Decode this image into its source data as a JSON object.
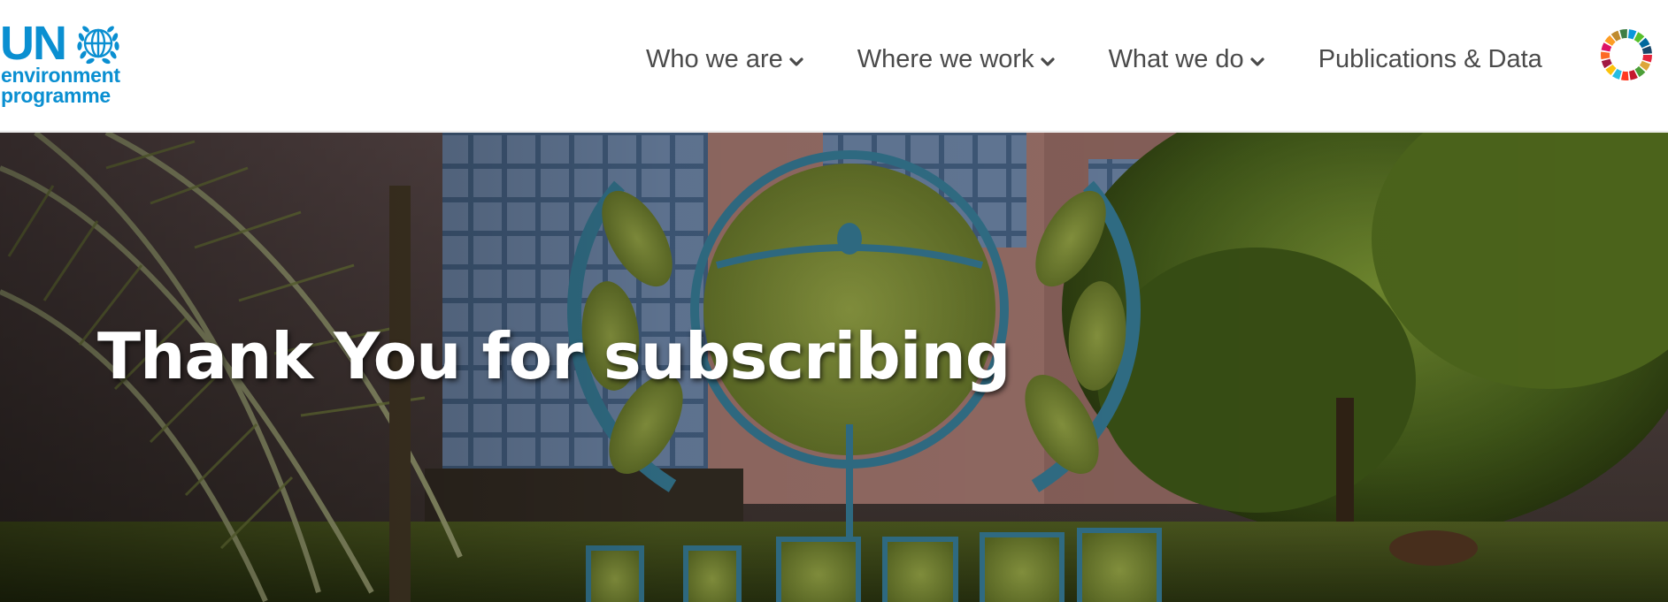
{
  "logo": {
    "un": "UN",
    "line1": "environment",
    "line2": "programme",
    "emblem_icon": "un-emblem-icon"
  },
  "nav": {
    "items": [
      {
        "label": "Who we are",
        "has_dropdown": true
      },
      {
        "label": "Where we work",
        "has_dropdown": true
      },
      {
        "label": "What we do",
        "has_dropdown": true
      },
      {
        "label": "Publications & Data",
        "has_dropdown": false
      }
    ],
    "sdg_icon": "sdg-wheel-icon"
  },
  "hero": {
    "title": "Thank You for subscribing",
    "background": "unep-headquarters-garden-photo"
  },
  "colors": {
    "brand_blue": "#0a8fd1",
    "nav_text": "#4a4a4a",
    "hero_text": "#ffffff"
  }
}
